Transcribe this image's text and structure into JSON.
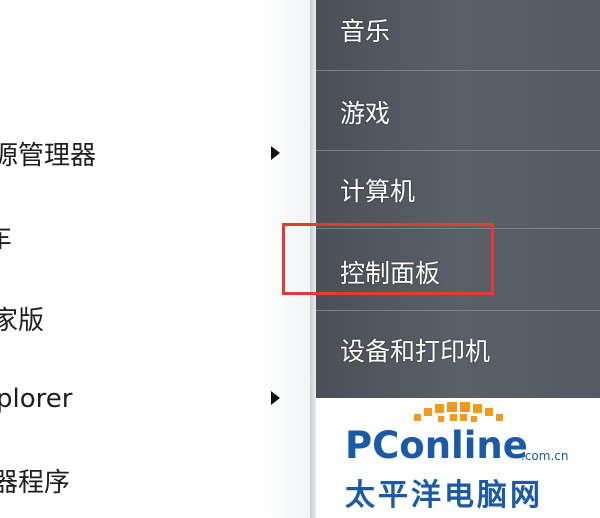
{
  "start_menu": {
    "left_items": [
      {
        "label": "源管理器",
        "has_submenu": true
      },
      {
        "label": "车",
        "has_submenu": false
      },
      {
        "label": "家版",
        "has_submenu": false
      },
      {
        "label": "plorer",
        "has_submenu": true
      },
      {
        "label": "器程序",
        "has_submenu": false
      }
    ],
    "right_items": [
      {
        "label": "音乐"
      },
      {
        "label": "游戏"
      },
      {
        "label": "计算机"
      },
      {
        "label": "控制面板",
        "highlighted": true
      },
      {
        "label": "设备和打印机"
      }
    ]
  },
  "annotation": {
    "highlight_color": "#e53935"
  },
  "watermark": {
    "brand": "PConline",
    "domain": ".com.cn",
    "chinese": "太平洋电脑网",
    "brand_color": "#1a5aa6",
    "dot_color": "#f39a1e"
  }
}
